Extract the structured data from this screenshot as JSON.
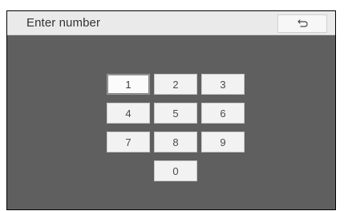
{
  "topbar": {
    "title": "Enter number",
    "back_icon": "undo-arrow-icon"
  },
  "keypad": {
    "keys": [
      "1",
      "2",
      "3",
      "4",
      "5",
      "6",
      "7",
      "8",
      "9",
      "0"
    ],
    "selected": "1"
  },
  "colors": {
    "panel_background": "#5f5f5f",
    "topbar_background": "#eaeaea",
    "key_background": "#f2f2f2"
  }
}
